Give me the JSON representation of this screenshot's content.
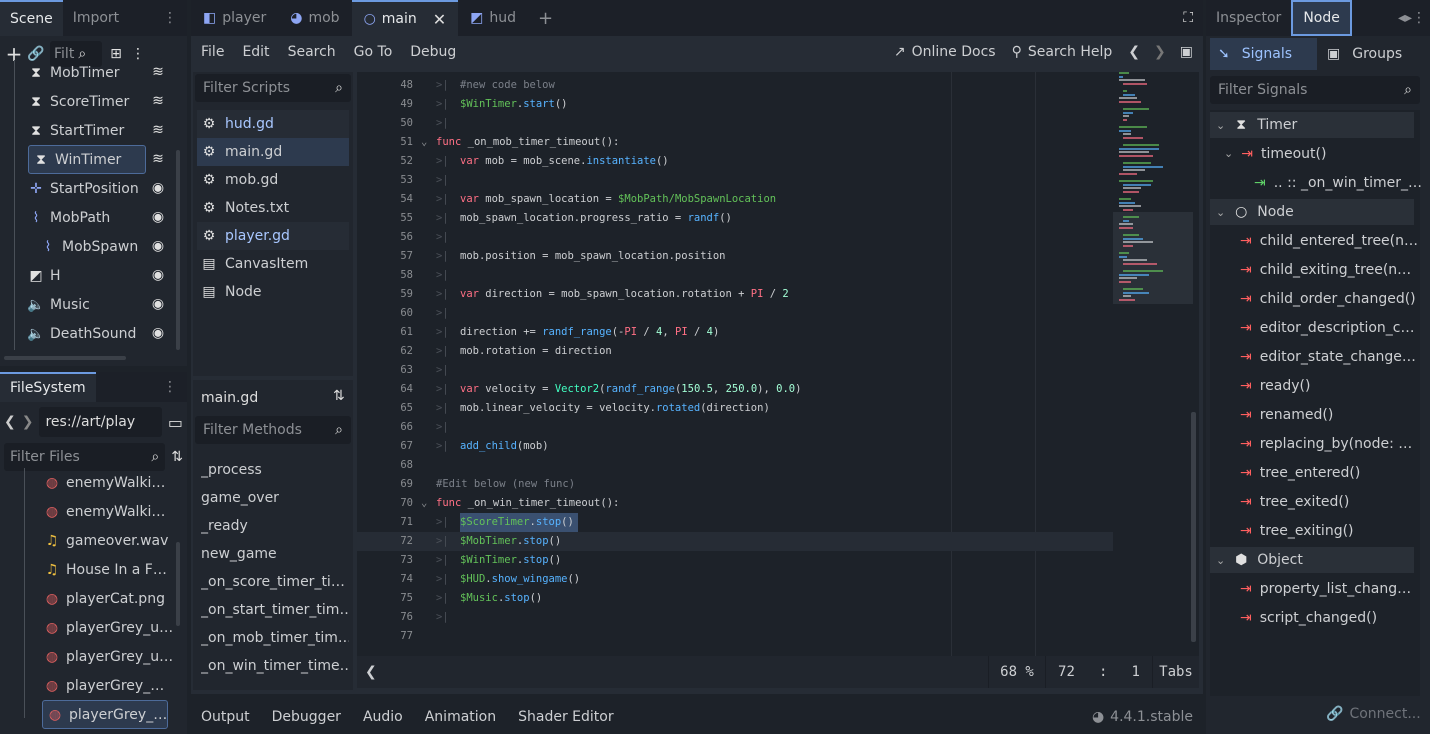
{
  "scene_dock": {
    "tab_scene": "Scene",
    "tab_import": "Import",
    "filter": "Filt",
    "nodes": [
      {
        "label": "MobTimer",
        "icon": "hourglass-icon",
        "side": "signal-icon",
        "indent": 1
      },
      {
        "label": "ScoreTimer",
        "icon": "hourglass-icon",
        "side": "signal-icon",
        "indent": 1
      },
      {
        "label": "StartTimer",
        "icon": "hourglass-icon",
        "side": "signal-icon",
        "indent": 1
      },
      {
        "label": "WinTimer",
        "icon": "hourglass-icon",
        "side": "signal-icon",
        "indent": 1,
        "selected": true
      },
      {
        "label": "StartPosition",
        "icon": "marker-icon",
        "side": "eye-icon",
        "indent": 1
      },
      {
        "label": "MobPath",
        "icon": "path-icon",
        "side": "eye-icon",
        "indent": 1
      },
      {
        "label": "MobSpawn",
        "icon": "pathfollow-icon",
        "side": "eye-icon",
        "indent": 2
      },
      {
        "label": "H",
        "icon": "canvas-layer-icon",
        "side": "eye-icon",
        "indent": 1
      },
      {
        "label": "Music",
        "icon": "speaker-icon",
        "side": "eye-icon",
        "indent": 1
      },
      {
        "label": "DeathSound",
        "icon": "speaker-icon",
        "side": "eye-icon",
        "indent": 1
      }
    ]
  },
  "filesystem": {
    "title": "FileSystem",
    "path": "res://art/play",
    "filter": "Filter Files",
    "files": [
      {
        "label": "enemyWalki…",
        "icon": "image-icon"
      },
      {
        "label": "enemyWalki…",
        "icon": "image-icon"
      },
      {
        "label": "gameover.wav",
        "icon": "audio-icon"
      },
      {
        "label": "House In a F…",
        "icon": "audio-icon"
      },
      {
        "label": "playerCat.png",
        "icon": "image-icon"
      },
      {
        "label": "playerGrey_u…",
        "icon": "image-icon"
      },
      {
        "label": "playerGrey_u…",
        "icon": "image-icon"
      },
      {
        "label": "playerGrey_…",
        "icon": "image-icon"
      },
      {
        "label": "playerGrey_…",
        "icon": "image-icon",
        "selected": true
      }
    ]
  },
  "editor_tabs": [
    {
      "label": "player",
      "icon": "scene-icon"
    },
    {
      "label": "mob",
      "icon": "globe-icon"
    },
    {
      "label": "main",
      "icon": "circle-icon",
      "active": true
    },
    {
      "label": "hud",
      "icon": "canvas-icon"
    }
  ],
  "menu": [
    "File",
    "Edit",
    "Search",
    "Go To",
    "Debug"
  ],
  "online_docs": "Online Docs",
  "search_help": "Search Help",
  "scripts": {
    "filter": "Filter Scripts",
    "items": [
      {
        "label": "hud.gd",
        "icon": "gear-icon",
        "hl": true
      },
      {
        "label": "main.gd",
        "icon": "gear-icon",
        "selected": true
      },
      {
        "label": "mob.gd",
        "icon": "gear-icon"
      },
      {
        "label": "Notes.txt",
        "icon": "gear-icon"
      },
      {
        "label": "player.gd",
        "icon": "gear-icon",
        "hl": true
      },
      {
        "label": "CanvasItem",
        "icon": "doc-icon"
      },
      {
        "label": "Node",
        "icon": "doc-icon"
      }
    ]
  },
  "methods": {
    "current": "main.gd",
    "filter": "Filter Methods",
    "items": [
      "_process",
      "game_over",
      "_ready",
      "new_game",
      "_on_score_timer_ti…",
      "_on_start_timer_tim…",
      "_on_mob_timer_tim…",
      "_on_win_timer_time…"
    ]
  },
  "code": [
    {
      "n": "48",
      "t": "#new code below",
      "c": "cm",
      "ind": 1
    },
    {
      "n": "49",
      "t": "$WinTimer.start()",
      "ind": 1
    },
    {
      "n": "50",
      "t": "",
      "ind": 1
    },
    {
      "n": "51",
      "t": "func _on_mob_timer_timeout():",
      "ind": 0,
      "fold": true
    },
    {
      "n": "52",
      "t": "var mob = mob_scene.instantiate()",
      "ind": 1
    },
    {
      "n": "53",
      "t": "",
      "ind": 1
    },
    {
      "n": "54",
      "t": "var mob_spawn_location = $MobPath/MobSpawnLocation",
      "ind": 1
    },
    {
      "n": "55",
      "t": "mob_spawn_location.progress_ratio = randf()",
      "ind": 1
    },
    {
      "n": "56",
      "t": "",
      "ind": 1
    },
    {
      "n": "57",
      "t": "mob.position = mob_spawn_location.position",
      "ind": 1
    },
    {
      "n": "58",
      "t": "",
      "ind": 1
    },
    {
      "n": "59",
      "t": "var direction = mob_spawn_location.rotation + PI / 2",
      "ind": 1
    },
    {
      "n": "60",
      "t": "",
      "ind": 1
    },
    {
      "n": "61",
      "t": "direction += randf_range(-PI / 4, PI / 4)",
      "ind": 1
    },
    {
      "n": "62",
      "t": "mob.rotation = direction",
      "ind": 1
    },
    {
      "n": "63",
      "t": "",
      "ind": 1
    },
    {
      "n": "64",
      "t": "var velocity = Vector2(randf_range(150.5, 250.0), 0.0)",
      "ind": 1
    },
    {
      "n": "65",
      "t": "mob.linear_velocity = velocity.rotated(direction)",
      "ind": 1
    },
    {
      "n": "66",
      "t": "",
      "ind": 1
    },
    {
      "n": "67",
      "t": "add_child(mob)",
      "ind": 1
    },
    {
      "n": "68",
      "t": "",
      "ind": 0
    },
    {
      "n": "69",
      "t": "#Edit below (new func)",
      "c": "cm",
      "ind": 0
    },
    {
      "n": "70",
      "t": "func _on_win_timer_timeout():",
      "ind": 0,
      "fold": true
    },
    {
      "n": "71",
      "t": "$ScoreTimer.stop()",
      "ind": 1,
      "selected": true
    },
    {
      "n": "72",
      "t": "$MobTimer.stop()",
      "ind": 1,
      "current": true
    },
    {
      "n": "73",
      "t": "$WinTimer.stop()",
      "ind": 1
    },
    {
      "n": "74",
      "t": "$HUD.show_wingame()",
      "ind": 1
    },
    {
      "n": "75",
      "t": "$Music.stop()",
      "ind": 1
    },
    {
      "n": "76",
      "t": "",
      "ind": 1
    },
    {
      "n": "77",
      "t": "",
      "ind": 0
    }
  ],
  "status": {
    "zoom": "68 %",
    "line": "72",
    "col": "1",
    "indent": "Tabs"
  },
  "bottom": {
    "tabs": [
      "Output",
      "Debugger",
      "Audio",
      "Animation",
      "Shader Editor"
    ],
    "version": "4.4.1.stable"
  },
  "inspector": {
    "tab_inspector": "Inspector",
    "tab_node": "Node",
    "signals": "Signals",
    "groups": "Groups",
    "filter": "Filter Signals",
    "connect": "Connect...",
    "rows": [
      {
        "type": "class",
        "label": "Timer",
        "icon": "hourglass-icon"
      },
      {
        "type": "signal",
        "label": "timeout()",
        "fold": true
      },
      {
        "type": "conn",
        "label": ".. :: _on_win_timer_…"
      },
      {
        "type": "class",
        "label": "Node",
        "icon": "circle-icon"
      },
      {
        "type": "signal",
        "label": "child_entered_tree(n…"
      },
      {
        "type": "signal",
        "label": "child_exiting_tree(n…"
      },
      {
        "type": "signal",
        "label": "child_order_changed()"
      },
      {
        "type": "signal",
        "label": "editor_description_c…"
      },
      {
        "type": "signal",
        "label": "editor_state_change…"
      },
      {
        "type": "signal",
        "label": "ready()"
      },
      {
        "type": "signal",
        "label": "renamed()"
      },
      {
        "type": "signal",
        "label": "replacing_by(node: …"
      },
      {
        "type": "signal",
        "label": "tree_entered()"
      },
      {
        "type": "signal",
        "label": "tree_exited()"
      },
      {
        "type": "signal",
        "label": "tree_exiting()"
      },
      {
        "type": "class",
        "label": "Object",
        "icon": "cube-icon"
      },
      {
        "type": "signal",
        "label": "property_list_chang…"
      },
      {
        "type": "signal",
        "label": "script_changed()"
      }
    ]
  },
  "colors": {
    "accent": "#6c9ae0",
    "signal": "#ff5f5f",
    "connected": "#5fd068"
  }
}
